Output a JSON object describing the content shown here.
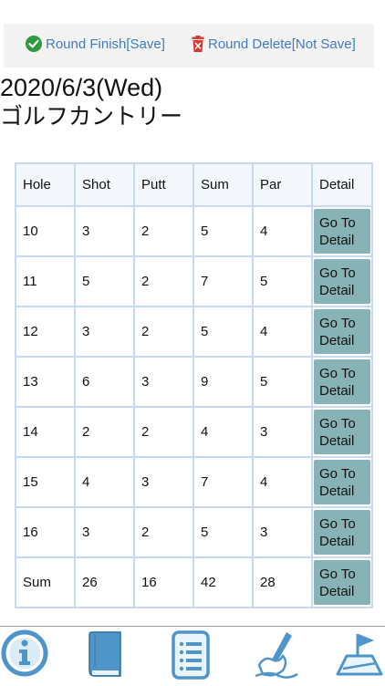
{
  "toolbar": {
    "finish_label": "Round Finish[Save]",
    "delete_label": "Round Delete[Not Save]"
  },
  "round": {
    "date": "2020/6/3(Wed)",
    "course": "ゴルフカントリー"
  },
  "table": {
    "headers": [
      "Hole",
      "Shot",
      "Putt",
      "Sum",
      "Par",
      "Detail"
    ],
    "rows": [
      [
        "10",
        "3",
        "2",
        "5",
        "4"
      ],
      [
        "11",
        "5",
        "2",
        "7",
        "5"
      ],
      [
        "12",
        "3",
        "2",
        "5",
        "4"
      ],
      [
        "13",
        "6",
        "3",
        "9",
        "5"
      ],
      [
        "14",
        "2",
        "2",
        "4",
        "3"
      ],
      [
        "15",
        "4",
        "3",
        "7",
        "4"
      ],
      [
        "16",
        "3",
        "2",
        "5",
        "3"
      ],
      [
        "Sum",
        "26",
        "16",
        "42",
        "28"
      ]
    ],
    "detail_label_1": "Go To",
    "detail_label_2": "Detail"
  },
  "tabbar": {
    "icons": [
      "info-icon",
      "book-icon",
      "document-list-icon",
      "writing-hand-icon",
      "course-flag-icon"
    ]
  },
  "colors": {
    "accent": "#3f7cc2",
    "detail_button": "#87b3b6",
    "grid": "#c7d9f3",
    "tab_icon": "#4f95c9",
    "delete_red": "#d63a33",
    "finish_green": "#2e9a3f"
  }
}
